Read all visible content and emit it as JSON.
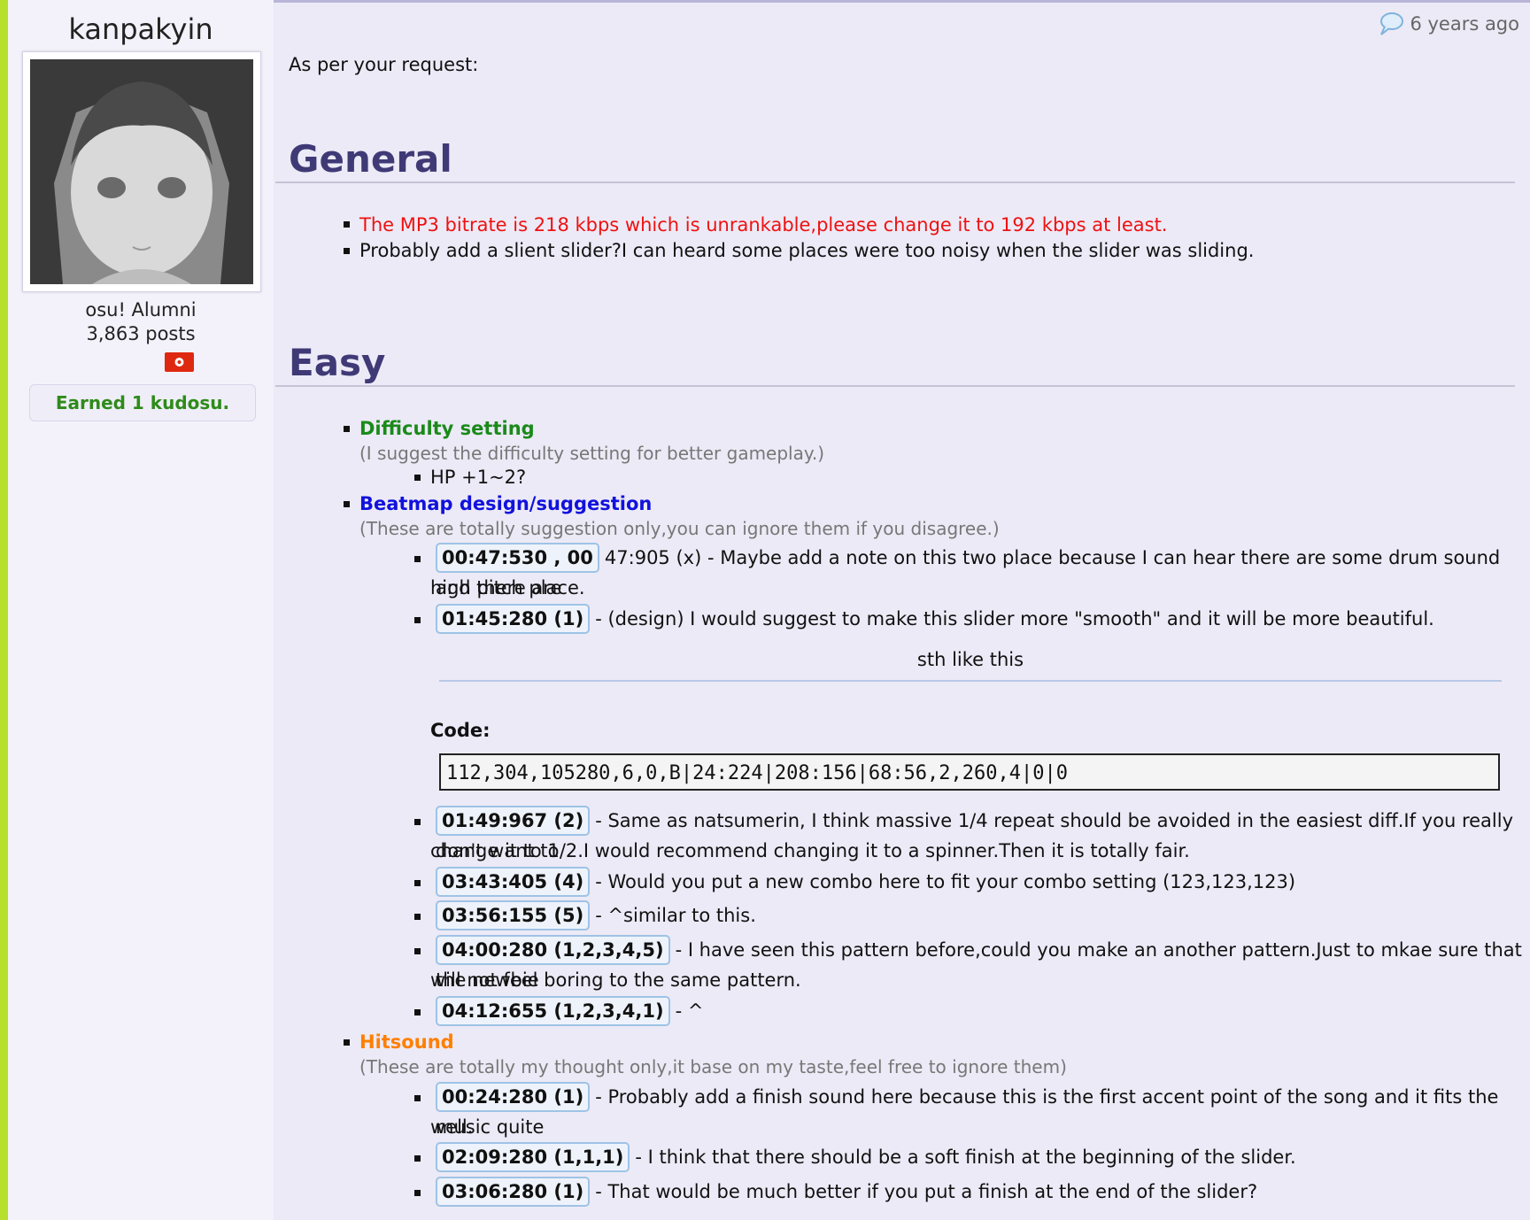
{
  "user": {
    "name": "kanpakyin",
    "group": "osu! Alumni",
    "posts": "3,863 posts",
    "kudosu": "Earned 1 kudosu."
  },
  "post": {
    "timestamp": "6 years ago",
    "intro": "As per your request:",
    "general": {
      "heading": "General",
      "items": [
        "The MP3 bitrate is 218 kbps which is unrankable,please change it to 192 kbps at least.",
        "Probably add a slient slider?I can heard some places were too noisy when the slider was sliding."
      ]
    },
    "easy": {
      "heading": "Easy",
      "difficulty": {
        "title": "Difficulty setting",
        "note": "(I suggest the difficulty setting for better gameplay.)",
        "items": [
          "HP +1~2?"
        ]
      },
      "design": {
        "title": "Beatmap design/suggestion",
        "note": "(These are totally suggestion only,you can ignore them if you disagree.)",
        "items": [
          {
            "ts": "00:47:530 , 00",
            "text": "47:905 (x) - Maybe add a note on this two place because I can hear there are some drum sound and there are",
            "text2": "high pitch place."
          },
          {
            "ts": "01:45:280 (1)",
            "text": "- (design) I would suggest to make this slider more \"smooth\" and it will be more beautiful."
          },
          {
            "ts": "01:49:967 (2)",
            "text": "- Same as natsumerin, I think massive 1/4 repeat should be avoided in the easiest diff.If you really don't want to",
            "text2": "change it to 1/2.I would recommend changing it to a spinner.Then it is totally fair."
          },
          {
            "ts": "03:43:405 (4)",
            "text": "- Would you put a new combo here to fit your combo setting (123,123,123)"
          },
          {
            "ts": "03:56:155 (5)",
            "text": "- ^similar to this."
          },
          {
            "ts": "04:00:280 (1,2,3,4,5)",
            "text": "- I have seen this pattern before,could you make an another pattern.Just to mkae sure that the newbie",
            "text2": "will not feel boring to the same pattern."
          },
          {
            "ts": "04:12:655 (1,2,3,4,1)",
            "text": "- ^"
          }
        ],
        "caption": "sth like this",
        "code_label": "Code:",
        "code": "112,304,105280,6,0,B|24:224|208:156|68:56,2,260,4|0|0"
      },
      "hitsound": {
        "title": "Hitsound",
        "note": "(These are totally my thought only,it base on my taste,feel free to ignore them)",
        "items": [
          {
            "ts": "00:24:280 (1)",
            "text": "- Probably add a finish sound here because this is the first accent point of the song and it fits the music quite",
            "text2": "well."
          },
          {
            "ts": "02:09:280 (1,1,1)",
            "text": "- I think that there should be a soft finish at the beginning of the slider."
          },
          {
            "ts": "03:06:280 (1)",
            "text": "- That would be much better if you put a finish at the end of the slider?"
          }
        ]
      }
    }
  },
  "colors": {
    "heading": "#3f3a76",
    "warning": "#ee1111",
    "difficulty_head": "#1a8a1a",
    "design_head": "#1111dd",
    "hitsound_head": "#ff7f00",
    "kudosu": "#2e8b1a"
  }
}
